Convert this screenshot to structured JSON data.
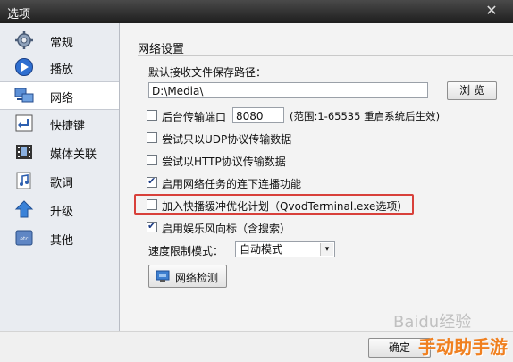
{
  "window": {
    "title": "选项",
    "close_glyph": "✕"
  },
  "sidebar": {
    "items": [
      {
        "label": "常规",
        "icon": "gear-icon",
        "selected": false
      },
      {
        "label": "播放",
        "icon": "play-icon",
        "selected": false
      },
      {
        "label": "网络",
        "icon": "network-icon",
        "selected": true
      },
      {
        "label": "快捷键",
        "icon": "shortcut-icon",
        "selected": false
      },
      {
        "label": "媒体关联",
        "icon": "film-icon",
        "selected": false
      },
      {
        "label": "歌词",
        "icon": "music-note-icon",
        "selected": false
      },
      {
        "label": "升级",
        "icon": "up-arrow-icon",
        "selected": false
      },
      {
        "label": "其他",
        "icon": "other-icon",
        "selected": false
      }
    ]
  },
  "network": {
    "section_title": "网络设置",
    "save_path_label": "默认接收文件保存路径：",
    "save_path_value": "D:\\Media\\",
    "browse_label": "浏 览",
    "background_port": {
      "label": "后台传输端口",
      "checked": false,
      "value": "8080",
      "range_text": "(范围:1-65535 重启系统后生效)"
    },
    "udp": {
      "label": "尝试只以UDP协议传输数据",
      "checked": false
    },
    "http": {
      "label": "尝试以HTTP协议传输数据",
      "checked": false
    },
    "resume": {
      "label": "启用网络任务的连下连播功能",
      "checked": true
    },
    "qvod": {
      "label": "加入快播缓冲优化计划（QvodTerminal.exe选项）",
      "checked": false
    },
    "wind_vane": {
      "label": "启用娱乐风向标（含搜索）",
      "checked": true
    },
    "speed_label": "速度限制模式：",
    "speed_value": "自动模式",
    "speed_arrow": "▾",
    "detect_label": "网络检测"
  },
  "footer": {
    "confirm_label": "确定"
  },
  "watermark": {
    "text": "Baidu经验",
    "brand": "手动助手游"
  }
}
